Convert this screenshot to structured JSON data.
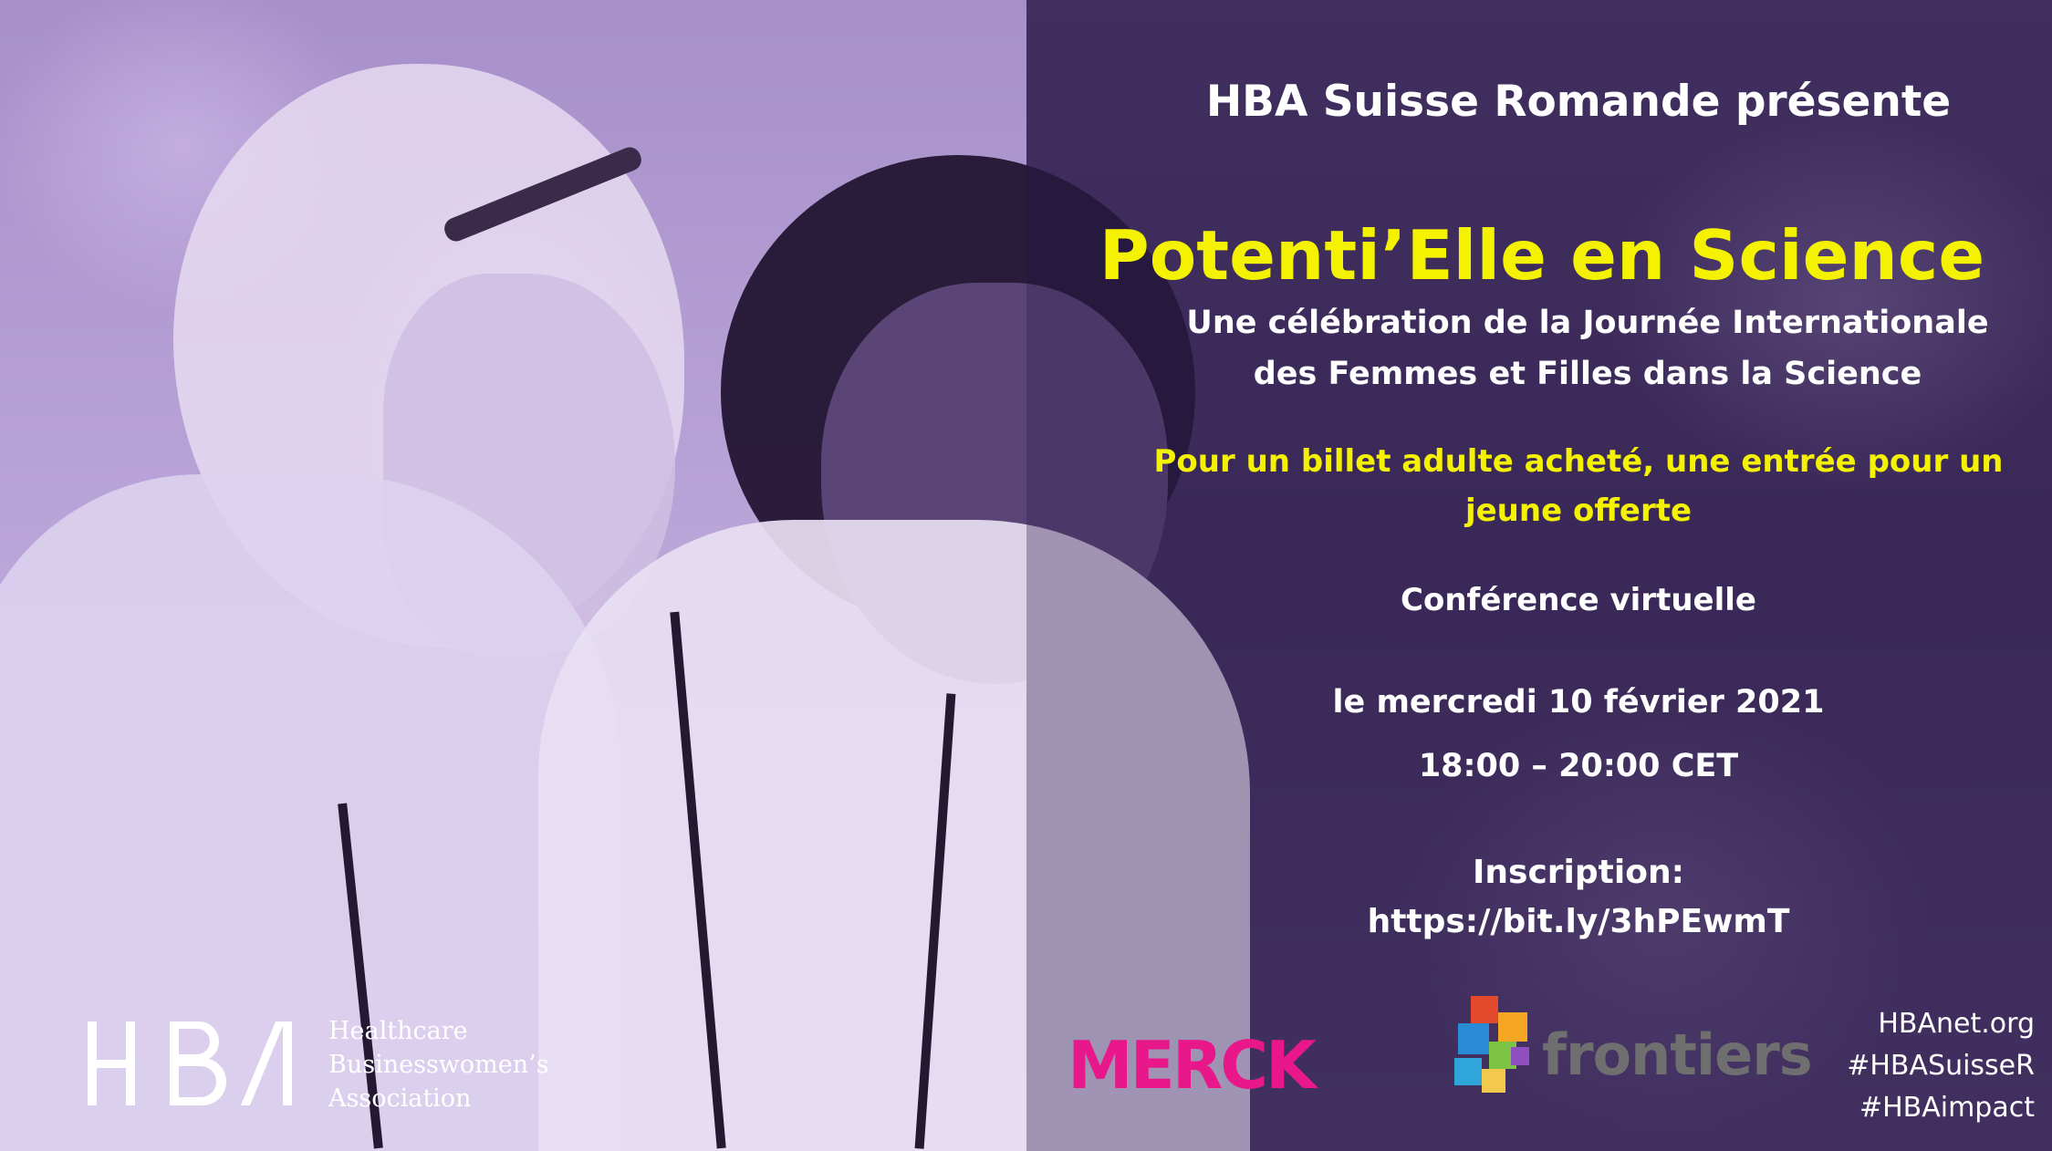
{
  "event": {
    "presents": "HBA Suisse Romande présente",
    "title": "Potenti’Elle en Science",
    "subtitle_line1": "Une célébration de la Journée Internationale",
    "subtitle_line2": "des Femmes et Filles dans la Science",
    "offer_line1": "Pour un billet adulte acheté,  une entrée pour un",
    "offer_line2": "jeune offerte",
    "format": "Conférence virtuelle",
    "date": "le mercredi 10 février 2021",
    "time": "18:00 – 20:00 CET",
    "registration_label": "Inscription:",
    "registration_link": "https://bit.ly/3hPEwmT"
  },
  "organizer": {
    "logo_letters": "HBA",
    "name_line1": "Healthcare",
    "name_line2": "Businesswomen’s",
    "name_line3": "Association"
  },
  "sponsors": {
    "merck": "MERCK",
    "frontiers": "frontiers"
  },
  "social": {
    "website": "HBAnet.org",
    "hashtag1": "#HBASuisseR",
    "hashtag2": "#HBAimpact"
  },
  "colors": {
    "accent_yellow": "#f4f200",
    "background_purple": "#3c2a57",
    "merck_pink": "#e8188a"
  }
}
